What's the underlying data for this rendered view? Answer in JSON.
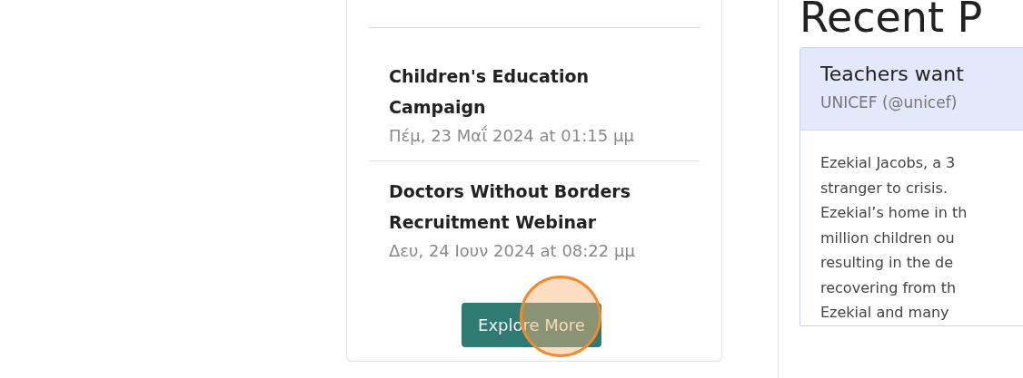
{
  "events": [
    {
      "title": "Children's Education Campaign",
      "date": "Πέμ, 23 Μαΐ 2024 at 01:15 μμ"
    },
    {
      "title": "Doctors Without Borders Recruitment Webinar",
      "date": "Δευ, 24 Ιουν 2024 at 08:22 μμ"
    }
  ],
  "explore_button": "Explore More",
  "recent": {
    "heading": "Recent P",
    "post": {
      "title": "Teachers want",
      "author": "UNICEF (@unicef)",
      "body_lines": [
        "Ezekial Jacobs, a 3",
        "stranger to crisis.",
        "Ezekial’s home in th",
        "million children ou",
        "resulting in the de",
        "recovering from th",
        "Ezekial and many"
      ]
    }
  }
}
